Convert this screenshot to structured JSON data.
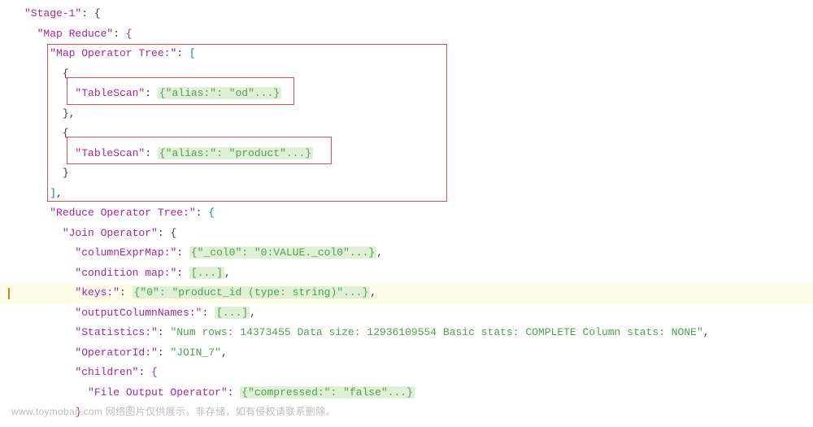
{
  "stage": {
    "key": "\"Stage-1\"",
    "mapReduce": {
      "key": "\"Map Reduce\"",
      "mapTree": {
        "key": "\"Map Operator Tree:\"",
        "scan1": {
          "key": "\"TableScan\"",
          "val": "{\"alias:\": \"od\"...}"
        },
        "scan2": {
          "key": "\"TableScan\"",
          "val": "{\"alias:\": \"product\"...}"
        }
      },
      "reduceTree": {
        "key": "\"Reduce Operator Tree:\"",
        "join": {
          "key": "\"Join Operator\"",
          "columnExprMap": {
            "key": "\"columnExprMap:\"",
            "val": "{\"_col0\": \"0:VALUE._col0\"...}"
          },
          "conditionMap": {
            "key": "\"condition map:\"",
            "val": "[...]"
          },
          "keys": {
            "key": "\"keys:\"",
            "val": "{\"0\": \"product_id (type: string)\"...}"
          },
          "outputColumnNames": {
            "key": "\"outputColumnNames:\"",
            "val": "[...]"
          },
          "statistics": {
            "key": "\"Statistics:\"",
            "val": "\"Num rows: 14373455 Data size: 12936109554 Basic stats: COMPLETE Column stats: NONE\""
          },
          "operatorId": {
            "key": "\"OperatorId:\"",
            "val": "\"JOIN_7\""
          },
          "children": {
            "key": "\"children\"",
            "fileOutput": {
              "key": "\"File Output Operator\"",
              "val": "{\"compressed:\": \"false\"...}"
            }
          }
        }
      }
    }
  },
  "watermark": "www.toymoban.com 网络图片仅供展示，非存储，如有侵权请联系删除。"
}
